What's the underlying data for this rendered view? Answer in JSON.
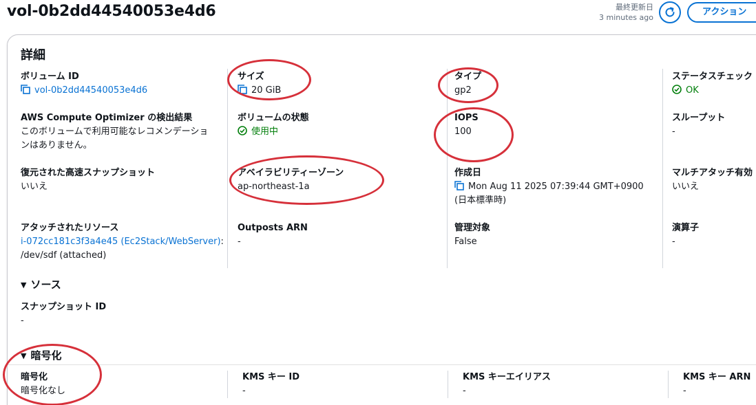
{
  "header": {
    "title": "vol-0b2dd44540053e4d6",
    "updated_label": "最終更新日",
    "updated_value": "3 minutes ago",
    "action_label": "アクション"
  },
  "details": {
    "title": "詳細",
    "volume_id": {
      "label": "ボリューム ID",
      "value": "vol-0b2dd44540053e4d6"
    },
    "size": {
      "label": "サイズ",
      "value": "20 GiB"
    },
    "type": {
      "label": "タイプ",
      "value": "gp2"
    },
    "status_check": {
      "label": "ステータスチェック",
      "value": "OK"
    },
    "optimizer": {
      "label": "AWS Compute Optimizer の検出結果",
      "value_line1": "このボリュームで利用可能なレコメンデーショ",
      "value_line2": "ンはありません。"
    },
    "volume_state": {
      "label": "ボリュームの状態",
      "value": "使用中"
    },
    "iops": {
      "label": "IOPS",
      "value": "100"
    },
    "throughput": {
      "label": "スループット",
      "value": "-"
    },
    "fast_snapshot": {
      "label": "復元された高速スナップショット",
      "value": "いいえ"
    },
    "az": {
      "label": "アベイラビリティーゾーン",
      "value": "ap-northeast-1a"
    },
    "created": {
      "label": "作成日",
      "value_line1": "Mon Aug 11 2025 07:39:44 GMT+0900",
      "value_line2": "(日本標準時)"
    },
    "multi_attach": {
      "label": "マルチアタッチ有効",
      "value": "いいえ"
    },
    "attached": {
      "label": "アタッチされたリソース",
      "link": "i-072cc181c3f3a4e45 (Ec2Stack/WebServer)",
      "suffix": ":",
      "value_line2": "/dev/sdf (attached)"
    },
    "outposts": {
      "label": "Outposts ARN",
      "value": "-"
    },
    "managed": {
      "label": "管理対象",
      "value": "False"
    },
    "operator": {
      "label": "演算子",
      "value": "-"
    }
  },
  "source": {
    "title": "ソース",
    "snapshot_id": {
      "label": "スナップショット ID",
      "value": "-"
    }
  },
  "encryption": {
    "title": "暗号化",
    "enc": {
      "label": "暗号化",
      "value": "暗号化なし"
    },
    "kms_id": {
      "label": "KMS キー ID",
      "value": "-"
    },
    "kms_alias": {
      "label": "KMS キーエイリアス",
      "value": "-"
    },
    "kms_arn": {
      "label": "KMS キー ARN",
      "value": "-"
    }
  },
  "colors": {
    "link": "#0972d3",
    "success": "#037f0c",
    "annotation": "#d6303a"
  }
}
